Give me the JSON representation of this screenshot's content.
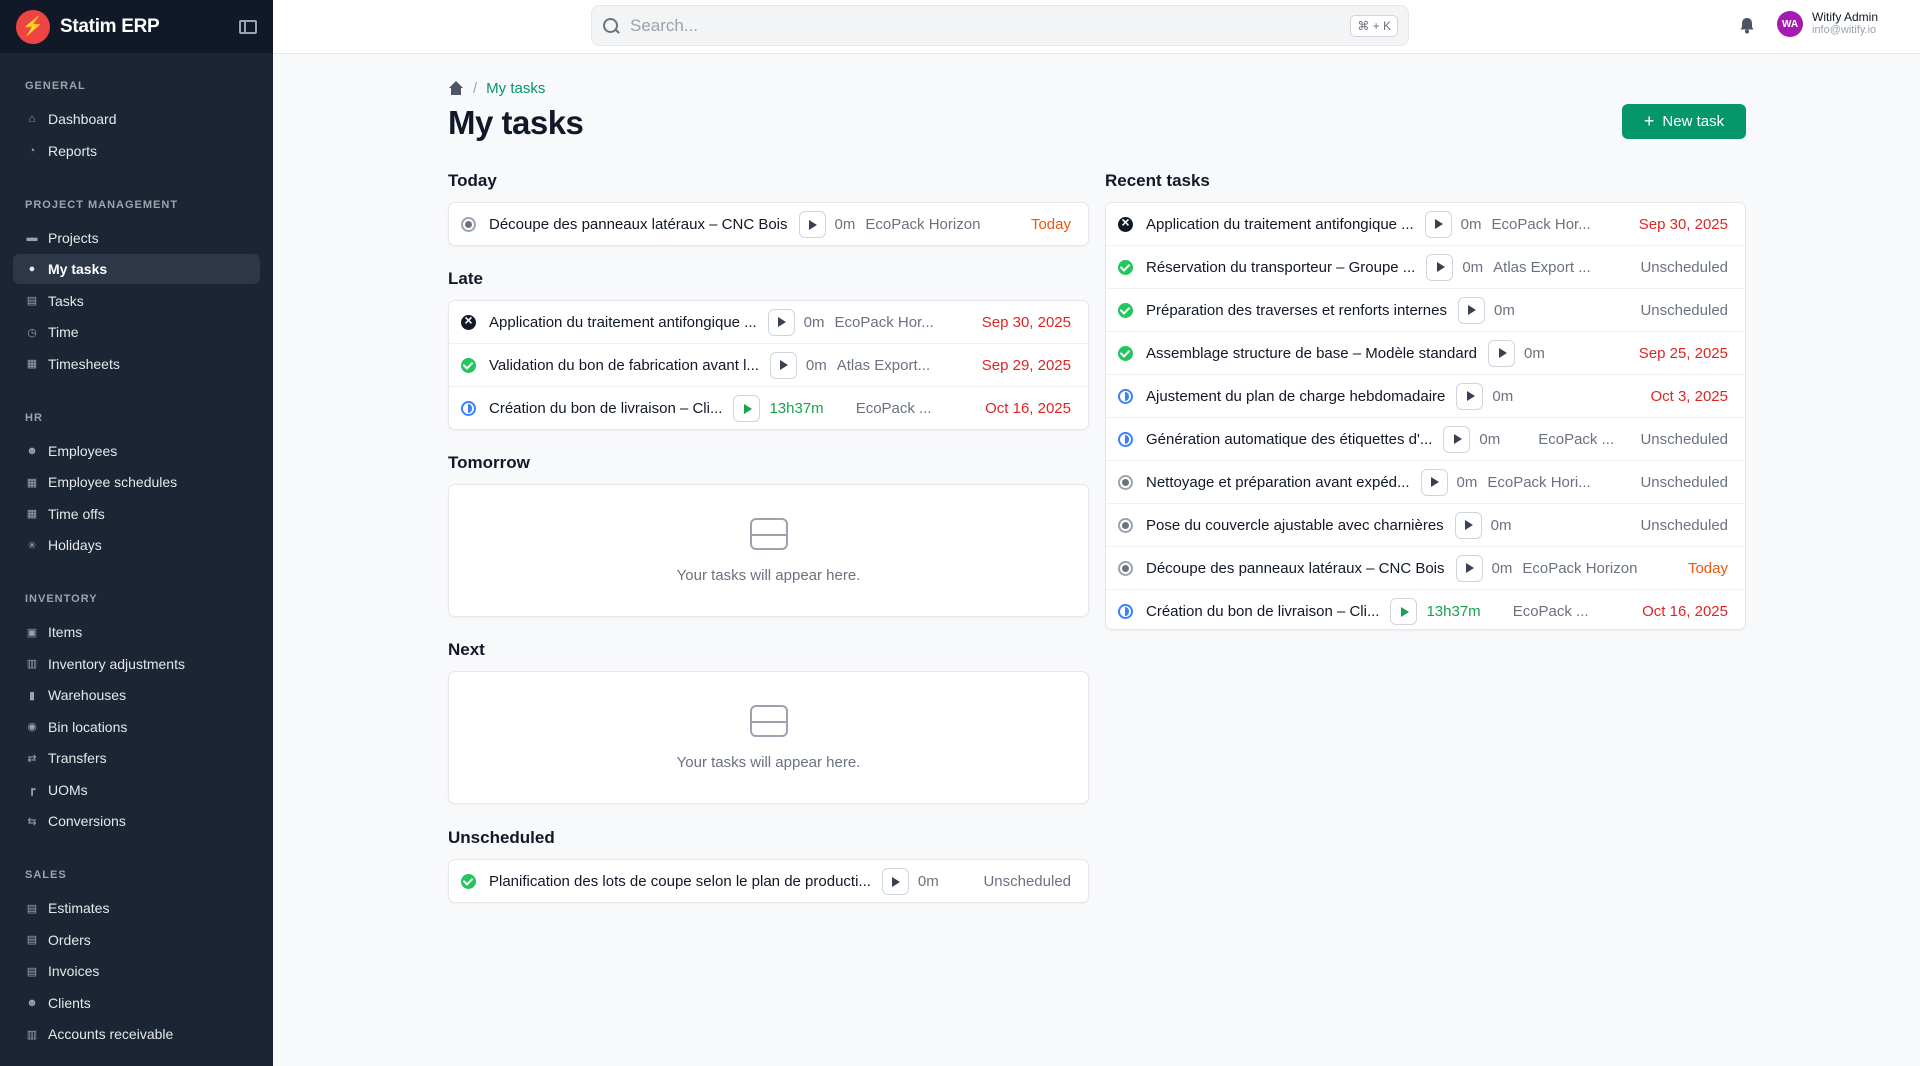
{
  "app": {
    "name": "Statim ERP"
  },
  "sidebar": {
    "sections": [
      {
        "heading": "GENERAL",
        "items": [
          {
            "label": "Dashboard",
            "icon": "home-icon"
          },
          {
            "label": "Reports",
            "icon": "chart-pie-icon"
          }
        ]
      },
      {
        "heading": "PROJECT MANAGEMENT",
        "items": [
          {
            "label": "Projects",
            "icon": "folder-icon"
          },
          {
            "label": "My tasks",
            "icon": "user-circle-icon",
            "active": true
          },
          {
            "label": "Tasks",
            "icon": "clipboard-icon"
          },
          {
            "label": "Time",
            "icon": "clock-icon"
          },
          {
            "label": "Timesheets",
            "icon": "calendar-icon"
          }
        ]
      },
      {
        "heading": "HR",
        "items": [
          {
            "label": "Employees",
            "icon": "users-icon"
          },
          {
            "label": "Employee schedules",
            "icon": "calendar-icon"
          },
          {
            "label": "Time offs",
            "icon": "calendar-icon"
          },
          {
            "label": "Holidays",
            "icon": "sun-icon"
          }
        ]
      },
      {
        "heading": "INVENTORY",
        "items": [
          {
            "label": "Items",
            "icon": "box-icon"
          },
          {
            "label": "Inventory adjustments",
            "icon": "adjust-icon"
          },
          {
            "label": "Warehouses",
            "icon": "building-icon"
          },
          {
            "label": "Bin locations",
            "icon": "location-icon"
          },
          {
            "label": "Transfers",
            "icon": "transfer-icon"
          },
          {
            "label": "UOMs",
            "icon": "ruler-icon"
          },
          {
            "label": "Conversions",
            "icon": "arrows-icon"
          }
        ]
      },
      {
        "heading": "SALES",
        "items": [
          {
            "label": "Estimates",
            "icon": "document-icon"
          },
          {
            "label": "Orders",
            "icon": "document-icon"
          },
          {
            "label": "Invoices",
            "icon": "document-icon"
          },
          {
            "label": "Clients",
            "icon": "users-icon"
          },
          {
            "label": "Accounts receivable",
            "icon": "bar-chart-icon"
          }
        ]
      }
    ]
  },
  "topbar": {
    "search_placeholder": "Search...",
    "shortcut": "⌘ + K",
    "user": {
      "initials": "WA",
      "name": "Witify Admin",
      "email": "info@witify.io"
    }
  },
  "page": {
    "breadcrumb": "My tasks",
    "title": "My tasks",
    "new_task_label": "New task"
  },
  "sections": {
    "today": {
      "title": "Today",
      "tasks": [
        {
          "name": "Découpe des panneaux latéraux – CNC Bois",
          "time": "0m",
          "project": "EcoPack Horizon",
          "due": "Today",
          "status": "gray",
          "due_color": "orange"
        }
      ]
    },
    "late": {
      "title": "Late",
      "tasks": [
        {
          "name": "Application du traitement antifongique ...",
          "time": "0m",
          "project": "EcoPack Hor...",
          "due": "Sep 30, 2025",
          "status": "black",
          "due_color": "red"
        },
        {
          "name": "Validation du bon de fabrication avant l...",
          "time": "0m",
          "project": "Atlas Export...",
          "due": "Sep 29, 2025",
          "status": "green",
          "due_color": "red"
        },
        {
          "name": "Création du bon de livraison – Cli...",
          "time": "13h37m",
          "project": "EcoPack ...",
          "due": "Oct 16, 2025",
          "status": "half",
          "due_color": "red",
          "running": true
        }
      ]
    },
    "tomorrow": {
      "title": "Tomorrow",
      "empty_text": "Your tasks will appear here."
    },
    "next": {
      "title": "Next",
      "empty_text": "Your tasks will appear here."
    },
    "unscheduled": {
      "title": "Unscheduled",
      "tasks": [
        {
          "name": "Planification des lots de coupe selon le plan de producti...",
          "time": "0m",
          "project": "",
          "due": "Unscheduled",
          "status": "green",
          "due_color": "gray"
        }
      ]
    },
    "recent": {
      "title": "Recent tasks",
      "tasks": [
        {
          "name": "Application du traitement antifongique ...",
          "time": "0m",
          "project": "EcoPack Hor...",
          "due": "Sep 30, 2025",
          "status": "black",
          "due_color": "red"
        },
        {
          "name": "Réservation du transporteur – Groupe ...",
          "time": "0m",
          "project": "Atlas Export ...",
          "due": "Unscheduled",
          "status": "green",
          "due_color": "gray"
        },
        {
          "name": "Préparation des traverses et renforts internes",
          "time": "0m",
          "project": "",
          "due": "Unscheduled",
          "status": "green",
          "due_color": "gray"
        },
        {
          "name": "Assemblage structure de base – Modèle standard",
          "time": "0m",
          "project": "",
          "due": "Sep 25, 2025",
          "status": "green",
          "due_color": "red"
        },
        {
          "name": "Ajustement du plan de charge hebdomadaire",
          "time": "0m",
          "project": "",
          "due": "Oct 3, 2025",
          "status": "half",
          "due_color": "red"
        },
        {
          "name": "Génération automatique des étiquettes d'...",
          "time": "0m",
          "project": "EcoPack ...",
          "due": "Unscheduled",
          "status": "half",
          "due_color": "gray"
        },
        {
          "name": "Nettoyage et préparation avant expéd...",
          "time": "0m",
          "project": "EcoPack Hori...",
          "due": "Unscheduled",
          "status": "gray",
          "due_color": "gray"
        },
        {
          "name": "Pose du couvercle ajustable avec charnières",
          "time": "0m",
          "project": "",
          "due": "Unscheduled",
          "status": "gray",
          "due_color": "gray"
        },
        {
          "name": "Découpe des panneaux latéraux – CNC Bois",
          "time": "0m",
          "project": "EcoPack Horizon",
          "due": "Today",
          "status": "gray",
          "due_color": "orange"
        },
        {
          "name": "Création du bon de livraison – Cli...",
          "time": "13h37m",
          "project": "EcoPack ...",
          "due": "Oct 16, 2025",
          "status": "half",
          "due_color": "red",
          "running": true
        }
      ]
    }
  },
  "colors": {
    "sidebar_bg": "#1c2533",
    "accent_green": "#059669",
    "due_red": "#dc2626",
    "due_orange": "#ea580c",
    "running_green": "#16a34a"
  }
}
